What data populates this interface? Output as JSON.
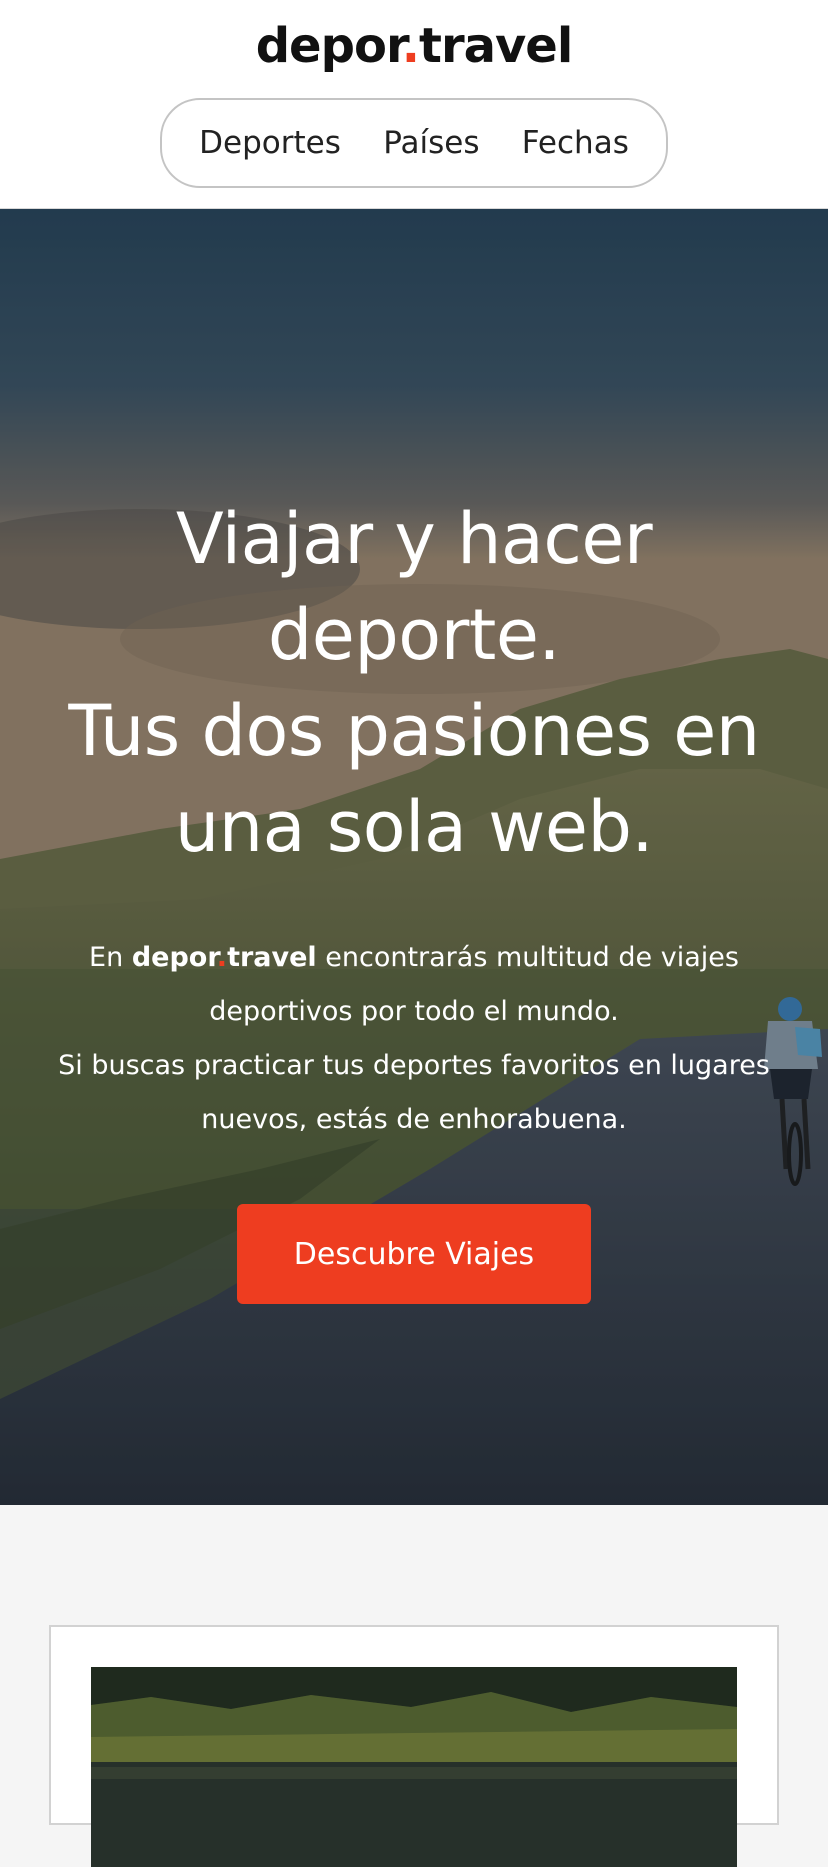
{
  "header": {
    "logo": {
      "part1": "depor",
      "dot": ".",
      "part2": "travel"
    },
    "nav": [
      {
        "label": "Deportes"
      },
      {
        "label": "Países"
      },
      {
        "label": "Fechas"
      }
    ]
  },
  "hero": {
    "title_line1": "Viajar y hacer",
    "title_line2": "deporte.",
    "title_line3": "Tus dos pasiones en",
    "title_line4": "una sola web.",
    "text": {
      "prefix": "En ",
      "brand_part1": "depor",
      "brand_dot": ".",
      "brand_part2": "travel",
      "after_brand": " encontrarás multitud de viajes deportivos por todo el mundo.",
      "second": "Si buscas practicar tus deportes favoritos en lugares nuevos, estás de enhorabuena."
    },
    "cta_label": "Descubre Viajes"
  },
  "colors": {
    "accent": "#ee3d20",
    "header_bg": "#ffffff",
    "page_bg": "#f5f5f5"
  }
}
